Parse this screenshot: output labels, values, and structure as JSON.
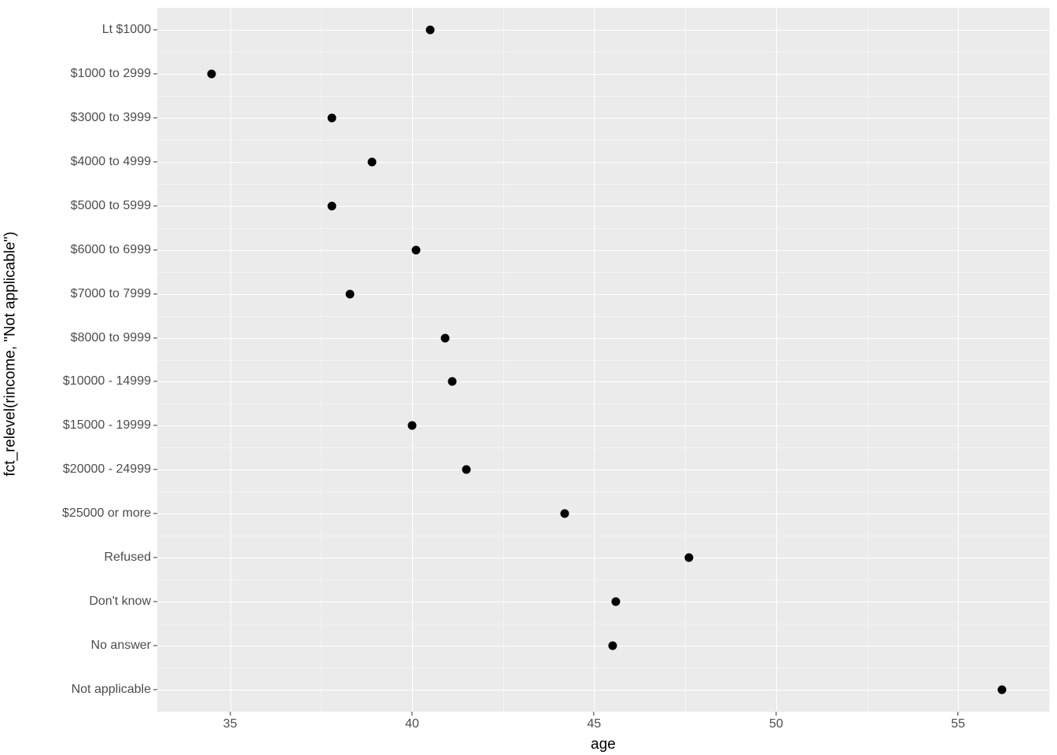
{
  "chart_data": {
    "type": "scatter",
    "xlabel": "age",
    "ylabel": "fct_relevel(rincome, \"Not applicable\")",
    "x_ticks": [
      35,
      40,
      45,
      50,
      55
    ],
    "xlim": [
      33,
      57.5
    ],
    "series": [
      {
        "category": "Lt $1000",
        "x": 40.5
      },
      {
        "category": "$1000 to 2999",
        "x": 34.5
      },
      {
        "category": "$3000 to 3999",
        "x": 37.8
      },
      {
        "category": "$4000 to 4999",
        "x": 38.9
      },
      {
        "category": "$5000 to 5999",
        "x": 37.8
      },
      {
        "category": "$6000 to 6999",
        "x": 40.1
      },
      {
        "category": "$7000 to 7999",
        "x": 38.3
      },
      {
        "category": "$8000 to 9999",
        "x": 40.9
      },
      {
        "category": "$10000 - 14999",
        "x": 41.1
      },
      {
        "category": "$15000 - 19999",
        "x": 40.0
      },
      {
        "category": "$20000 - 24999",
        "x": 41.5
      },
      {
        "category": "$25000 or more",
        "x": 44.2
      },
      {
        "category": "Refused",
        "x": 47.6
      },
      {
        "category": "Don't know",
        "x": 45.6
      },
      {
        "category": "No answer",
        "x": 45.5
      },
      {
        "category": "Not applicable",
        "x": 56.2
      }
    ]
  }
}
